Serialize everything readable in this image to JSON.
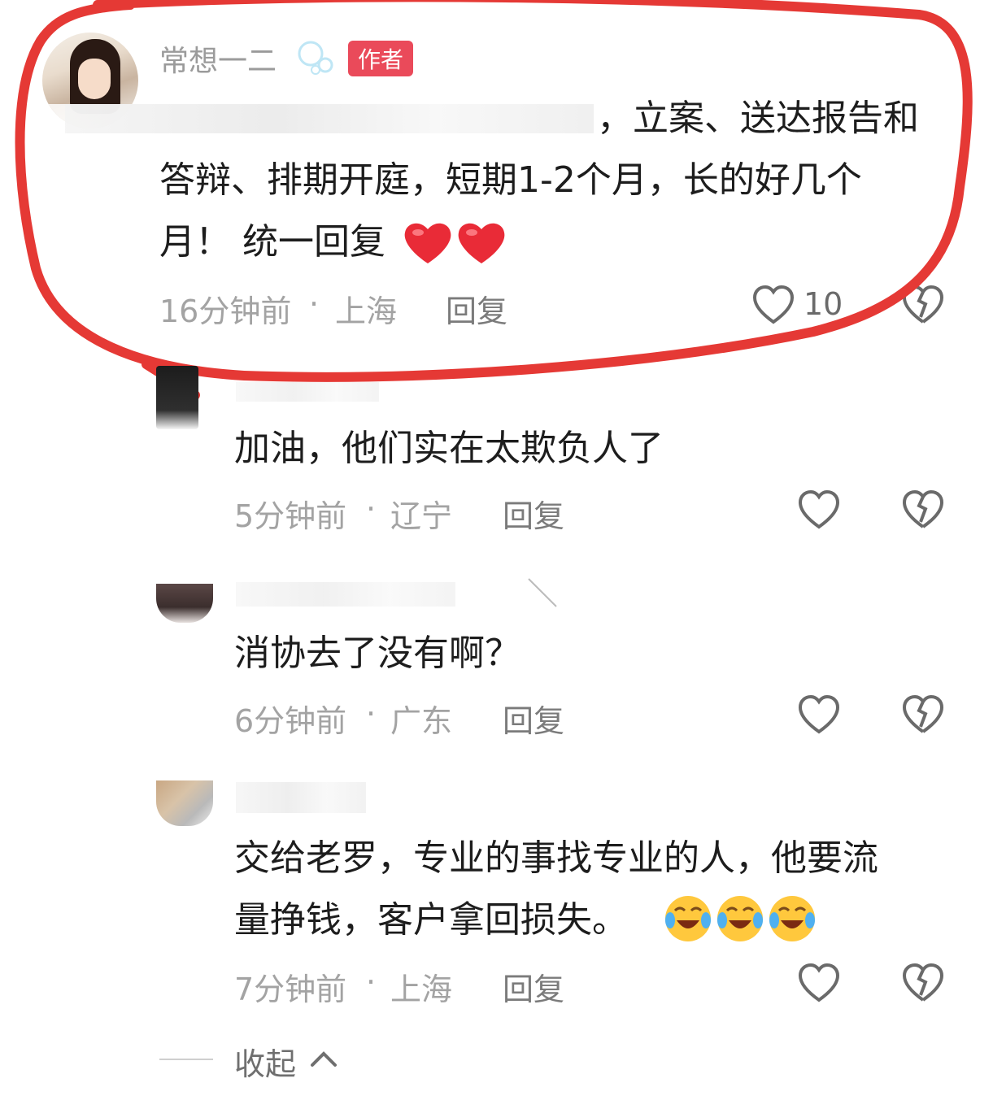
{
  "author_comment": {
    "username": "常想一二",
    "tag": "作者",
    "content_line1": "，立案、送达报告和",
    "content_line2": "答辩、排期开庭，短期1-2个月，长的好几个",
    "content_line3": "月！ 统一回复",
    "emoji_icons": [
      "heart-emoji",
      "heart-emoji"
    ],
    "time": "16分钟前",
    "location": "上海",
    "reply_label": "回复",
    "like_count": "10"
  },
  "replies": [
    {
      "content": "加油，他们实在太欺负人了",
      "time": "5分钟前",
      "location": "辽宁",
      "reply_label": "回复"
    },
    {
      "content": "消协去了没有啊？",
      "time": "6分钟前",
      "location": "广东",
      "reply_label": "回复"
    },
    {
      "content_line1": "交给老罗，专业的事找专业的人，他要流",
      "content_line2": "量挣钱，客户拿回损失。",
      "emoji_icons": [
        "crying-laughing-emoji",
        "crying-laughing-emoji",
        "crying-laughing-emoji"
      ],
      "time": "7分钟前",
      "location": "上海",
      "reply_label": "回复"
    }
  ],
  "collapse_label": "收起",
  "separator": "·",
  "colors": {
    "tag_bg": "#ea4a5a",
    "annotation": "#e53935"
  }
}
